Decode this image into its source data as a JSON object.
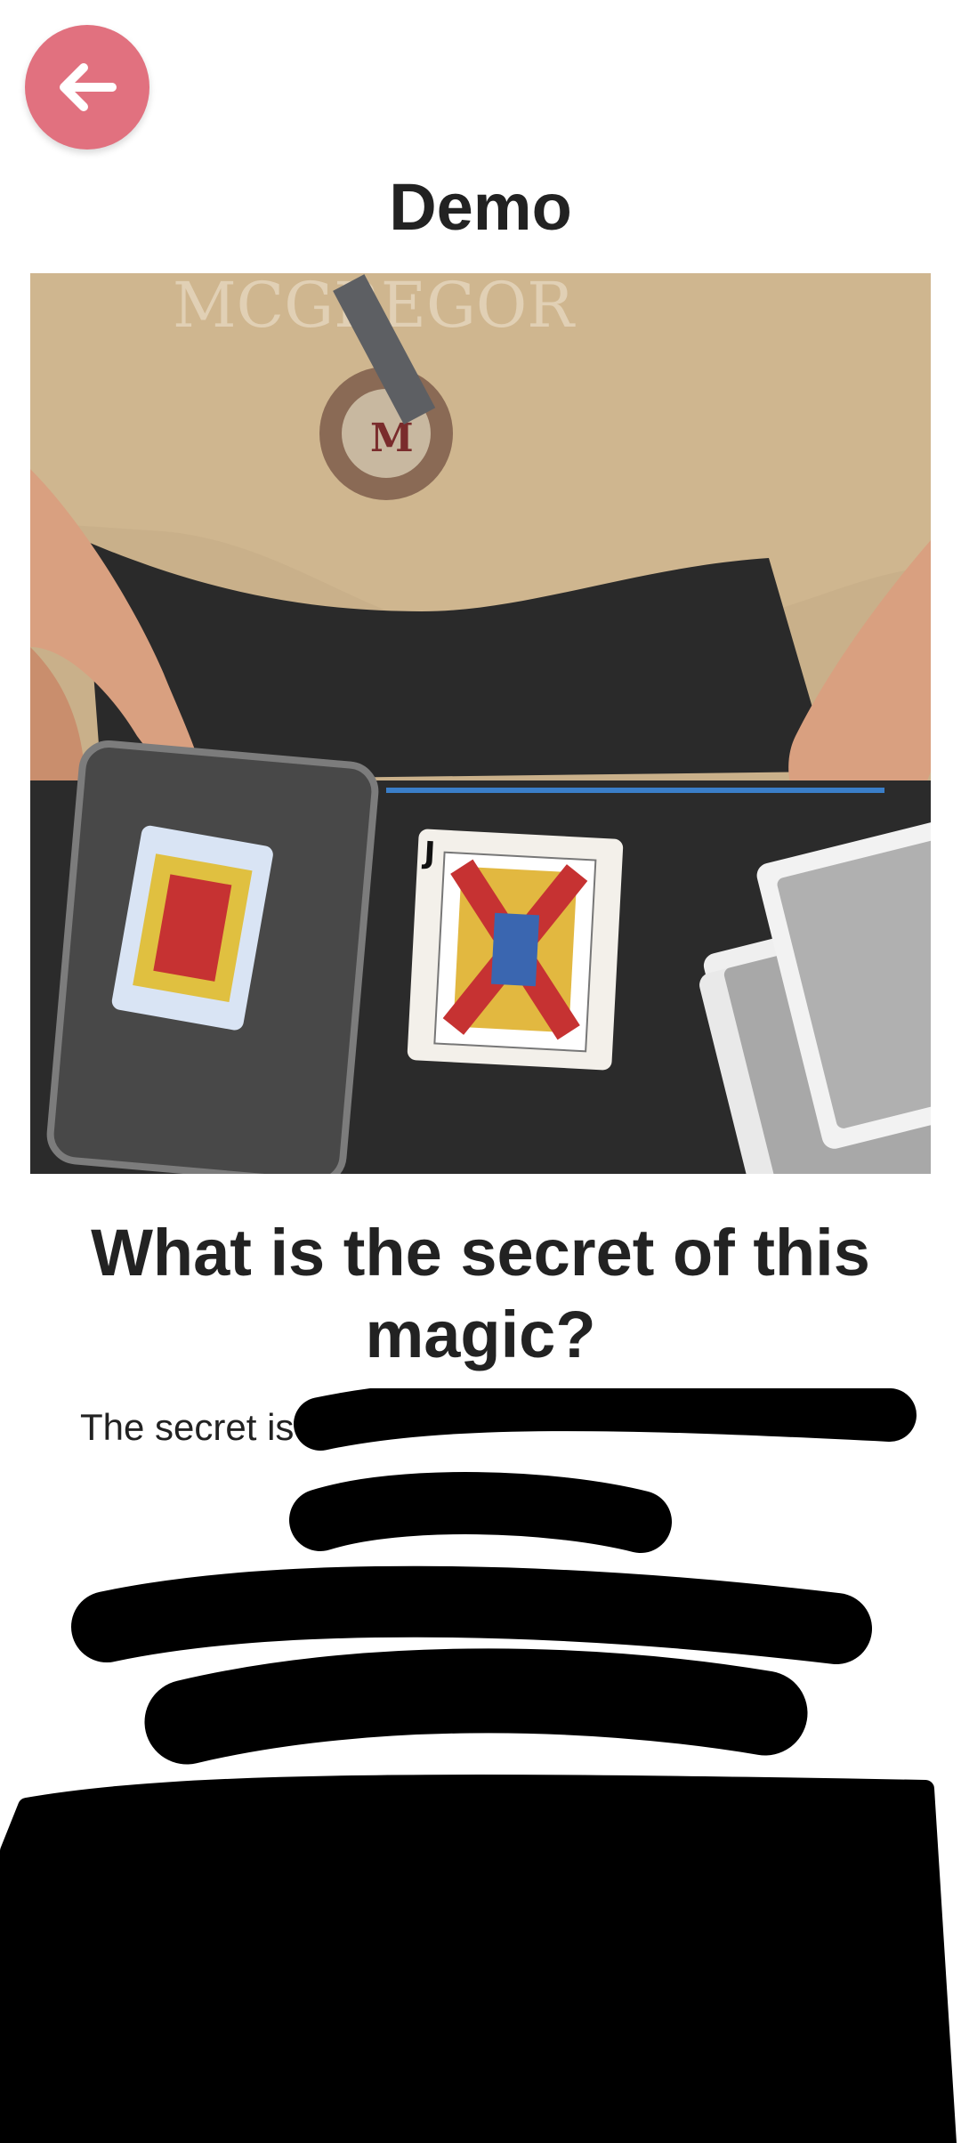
{
  "header": {
    "back_icon": "arrow-left-icon",
    "back_button_color": "#e1717f",
    "title": "Demo"
  },
  "demo": {
    "shirt_text": "MCGREGOR",
    "badge_text": "M"
  },
  "content": {
    "question": "What is the secret of this magic?",
    "secret_intro": "The secret is"
  }
}
